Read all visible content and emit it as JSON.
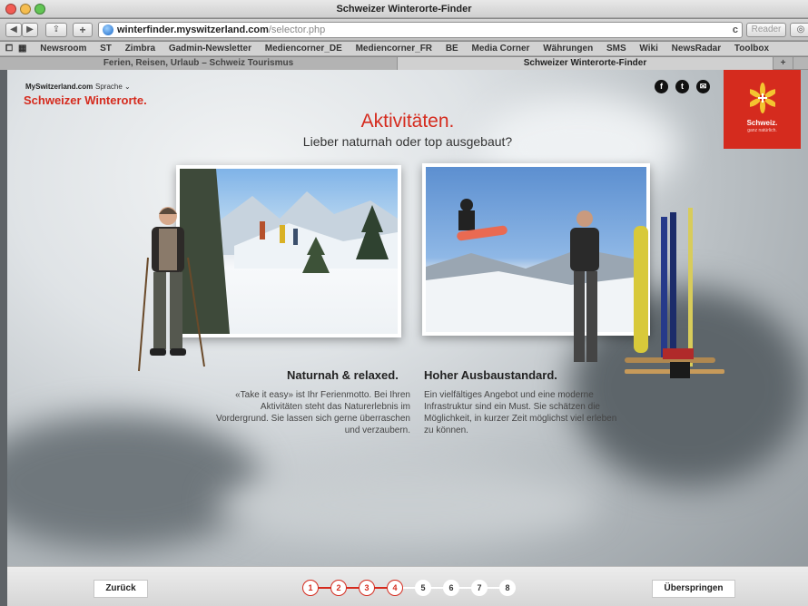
{
  "window": {
    "title": "Schweizer Winterorte-Finder"
  },
  "toolbar": {
    "url_domain": "winterfinder.myswitzerland.com",
    "url_path": "/selector.php",
    "reader_label": "Reader",
    "reload_icon": "reload-icon"
  },
  "bookmarks": [
    "Newsroom",
    "ST",
    "Zimbra",
    "Gadmin-Newsletter",
    "Mediencorner_DE",
    "Mediencorner_FR",
    "BE",
    "Media Corner",
    "Währungen",
    "SMS",
    "Wiki",
    "NewsRadar",
    "Toolbox"
  ],
  "tabs": [
    {
      "label": "Ferien, Reisen, Urlaub – Schweiz Tourismus"
    },
    {
      "label": "Schweizer Winterorte-Finder"
    }
  ],
  "site": {
    "brand_small": "MySwitzerland.com",
    "sprache": "Sprache",
    "brand_red": "Schweizer Winterorte.",
    "logo_text": "Schweiz.",
    "logo_sub": "ganz natürlich."
  },
  "heading": {
    "title": "Aktivitäten.",
    "subtitle": "Lieber naturnah oder top ausgebaut?"
  },
  "options": [
    {
      "title": "Naturnah & relaxed.",
      "text": "«Take it easy» ist Ihr Ferienmotto. Bei Ihren Aktivitäten steht das Naturerlebnis im Vordergrund. Sie lassen sich gerne überraschen und verzaubern."
    },
    {
      "title": "Hoher Ausbaustandard.",
      "text": "Ein vielfältiges Angebot und eine moderne Infrastruktur sind ein Must. Sie schätzen die Möglichkeit, in kurzer Zeit möglichst viel erleben zu können."
    }
  ],
  "footer": {
    "back_label": "Zurück",
    "skip_label": "Überspringen",
    "steps": [
      "1",
      "2",
      "3",
      "4",
      "5",
      "6",
      "7",
      "8"
    ],
    "completed_steps": 4
  },
  "colors": {
    "accent": "#d52b1e"
  }
}
